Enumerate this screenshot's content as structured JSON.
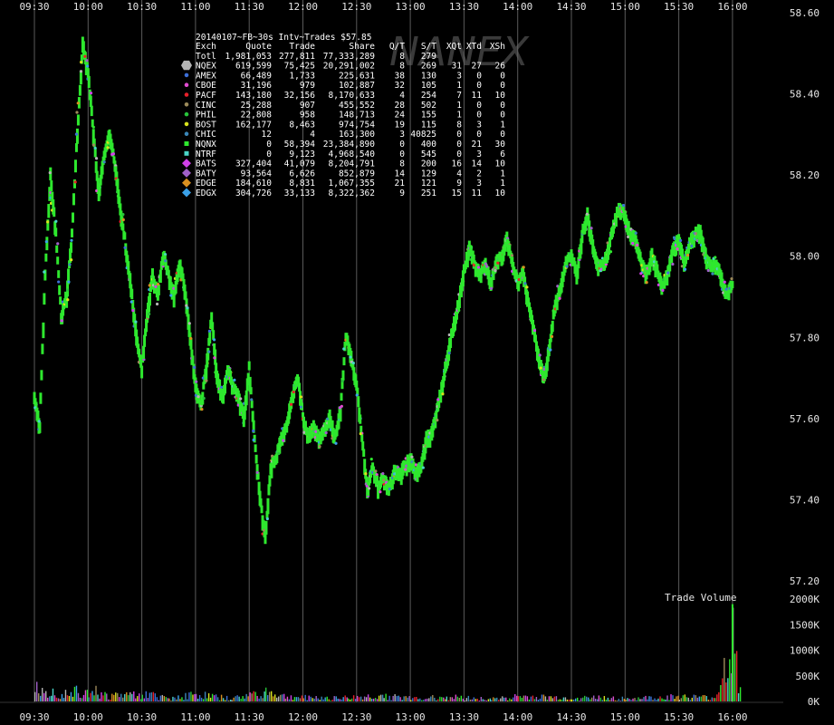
{
  "chart_data": {
    "type": "scatter",
    "title": "20140107~FB~30s Intv~Trades $57.85",
    "watermark": "NANEX",
    "background": "#000000",
    "grid": "vertical only",
    "x_ticks": [
      "09:30",
      "10:00",
      "10:30",
      "11:00",
      "11:30",
      "12:00",
      "12:30",
      "13:00",
      "13:30",
      "14:00",
      "14:30",
      "15:00",
      "15:30",
      "16:00"
    ],
    "price_axis": {
      "ylim": [
        57.1,
        58.6
      ],
      "tick_labels": [
        "58.60",
        "58.40",
        "58.20",
        "58.00",
        "57.80",
        "57.60",
        "57.40",
        "57.20"
      ],
      "tick_values": [
        58.6,
        58.4,
        58.2,
        58.0,
        57.8,
        57.6,
        57.4,
        57.2
      ]
    },
    "volume_axis": {
      "label": "Trade Volume",
      "ylim": [
        0,
        2000000
      ],
      "tick_labels": [
        "2000K",
        "1500K",
        "1000K",
        "500K",
        "0K"
      ],
      "tick_values": [
        2000000,
        1500000,
        1000000,
        500000,
        0
      ]
    },
    "table": {
      "headers": [
        "Exch",
        "Quote",
        "Trade",
        "Share",
        "Q/T",
        "S/T",
        "XQt",
        "XTd",
        "XSh"
      ],
      "total": {
        "label": "Totl",
        "quote": "1,981,053",
        "trade": "277,811",
        "share": "77,333,289",
        "qt": "8",
        "st": "279"
      },
      "rows": [
        {
          "exch": "NQEX",
          "quote": "619,599",
          "trade": "75,425",
          "share": "20,291,002",
          "qt": "8",
          "st": "269",
          "xqt": "31",
          "xtd": "27",
          "xsh": "26",
          "color": "#b4b4b4",
          "marker": "hexagon"
        },
        {
          "exch": "AMEX",
          "quote": "66,489",
          "trade": "1,733",
          "share": "225,631",
          "qt": "38",
          "st": "130",
          "xqt": "3",
          "xtd": "0",
          "xsh": "0",
          "color": "#3d6fd8",
          "marker": "circle"
        },
        {
          "exch": "CBOE",
          "quote": "31,196",
          "trade": "979",
          "share": "102,887",
          "qt": "32",
          "st": "105",
          "xqt": "1",
          "xtd": "0",
          "xsh": "0",
          "color": "#e04bd0",
          "marker": "circle"
        },
        {
          "exch": "PACF",
          "quote": "143,180",
          "trade": "32,156",
          "share": "8,170,633",
          "qt": "4",
          "st": "254",
          "xqt": "7",
          "xtd": "11",
          "xsh": "10",
          "color": "#e8202a",
          "marker": "circle"
        },
        {
          "exch": "CINC",
          "quote": "25,288",
          "trade": "907",
          "share": "455,552",
          "qt": "28",
          "st": "502",
          "xqt": "1",
          "xtd": "0",
          "xsh": "0",
          "color": "#9c8a5a",
          "marker": "circle"
        },
        {
          "exch": "PHIL",
          "quote": "22,808",
          "trade": "958",
          "share": "148,713",
          "qt": "24",
          "st": "155",
          "xqt": "1",
          "xtd": "0",
          "xsh": "0",
          "color": "#27c43a",
          "marker": "circle"
        },
        {
          "exch": "BOST",
          "quote": "162,177",
          "trade": "8,463",
          "share": "974,754",
          "qt": "19",
          "st": "115",
          "xqt": "8",
          "xtd": "3",
          "xsh": "1",
          "color": "#d8e21c",
          "marker": "circle"
        },
        {
          "exch": "CHIC",
          "quote": "12",
          "trade": "4",
          "share": "163,300",
          "qt": "3",
          "st": "40825",
          "xqt": "0",
          "xtd": "0",
          "xsh": "0",
          "color": "#3a86b8",
          "marker": "circle"
        },
        {
          "exch": "NQNX",
          "quote": "0",
          "trade": "58,394",
          "share": "23,384,890",
          "qt": "0",
          "st": "400",
          "xqt": "0",
          "xtd": "21",
          "xsh": "30",
          "color": "#2ee82e",
          "marker": "square"
        },
        {
          "exch": "NTRF",
          "quote": "0",
          "trade": "9,123",
          "share": "4,968,540",
          "qt": "0",
          "st": "545",
          "xqt": "0",
          "xtd": "3",
          "xsh": "6",
          "color": "#4ad4c8",
          "marker": "square"
        },
        {
          "exch": "BATS",
          "quote": "327,404",
          "trade": "41,079",
          "share": "8,204,791",
          "qt": "8",
          "st": "200",
          "xqt": "16",
          "xtd": "14",
          "xsh": "10",
          "color": "#d040e8",
          "marker": "diamond"
        },
        {
          "exch": "BATY",
          "quote": "93,564",
          "trade": "6,626",
          "share": "852,879",
          "qt": "14",
          "st": "129",
          "xqt": "4",
          "xtd": "2",
          "xsh": "1",
          "color": "#a060c8",
          "marker": "diamond"
        },
        {
          "exch": "EDGE",
          "quote": "184,610",
          "trade": "8,831",
          "share": "1,067,355",
          "qt": "21",
          "st": "121",
          "xqt": "9",
          "xtd": "3",
          "xsh": "1",
          "color": "#d89020",
          "marker": "diamond"
        },
        {
          "exch": "EDGX",
          "quote": "304,726",
          "trade": "33,133",
          "share": "8,322,362",
          "qt": "9",
          "st": "251",
          "xqt": "15",
          "xtd": "11",
          "xsh": "10",
          "color": "#3aa0e8",
          "marker": "diamond"
        }
      ]
    },
    "price_series": [
      [
        "09:30",
        57.65
      ],
      [
        "09:33",
        57.58
      ],
      [
        "09:36",
        57.95
      ],
      [
        "09:39",
        58.2
      ],
      [
        "09:42",
        58.05
      ],
      [
        "09:45",
        57.85
      ],
      [
        "09:48",
        57.9
      ],
      [
        "09:51",
        58.05
      ],
      [
        "09:54",
        58.3
      ],
      [
        "09:57",
        58.52
      ],
      [
        "10:00",
        58.45
      ],
      [
        "10:03",
        58.3
      ],
      [
        "10:06",
        58.15
      ],
      [
        "10:09",
        58.25
      ],
      [
        "10:12",
        58.3
      ],
      [
        "10:15",
        58.22
      ],
      [
        "10:18",
        58.12
      ],
      [
        "10:21",
        58.02
      ],
      [
        "10:24",
        57.92
      ],
      [
        "10:27",
        57.8
      ],
      [
        "10:30",
        57.72
      ],
      [
        "10:33",
        57.85
      ],
      [
        "10:36",
        57.95
      ],
      [
        "10:39",
        57.9
      ],
      [
        "10:42",
        58.0
      ],
      [
        "10:45",
        57.95
      ],
      [
        "10:48",
        57.9
      ],
      [
        "10:51",
        57.98
      ],
      [
        "10:54",
        57.92
      ],
      [
        "10:57",
        57.8
      ],
      [
        "11:00",
        57.68
      ],
      [
        "11:03",
        57.62
      ],
      [
        "11:06",
        57.72
      ],
      [
        "11:09",
        57.85
      ],
      [
        "11:12",
        57.7
      ],
      [
        "11:15",
        57.65
      ],
      [
        "11:18",
        57.72
      ],
      [
        "11:21",
        57.68
      ],
      [
        "11:24",
        57.65
      ],
      [
        "11:27",
        57.6
      ],
      [
        "11:30",
        57.72
      ],
      [
        "11:33",
        57.55
      ],
      [
        "11:36",
        57.4
      ],
      [
        "11:39",
        57.3
      ],
      [
        "11:42",
        57.48
      ],
      [
        "11:45",
        57.5
      ],
      [
        "11:48",
        57.55
      ],
      [
        "11:51",
        57.58
      ],
      [
        "11:54",
        57.65
      ],
      [
        "11:57",
        57.7
      ],
      [
        "12:00",
        57.6
      ],
      [
        "12:03",
        57.55
      ],
      [
        "12:06",
        57.58
      ],
      [
        "12:09",
        57.55
      ],
      [
        "12:12",
        57.57
      ],
      [
        "12:15",
        57.6
      ],
      [
        "12:18",
        57.55
      ],
      [
        "12:21",
        57.62
      ],
      [
        "12:24",
        57.8
      ],
      [
        "12:27",
        57.75
      ],
      [
        "12:30",
        57.68
      ],
      [
        "12:33",
        57.55
      ],
      [
        "12:36",
        57.42
      ],
      [
        "12:39",
        57.48
      ],
      [
        "12:42",
        57.43
      ],
      [
        "12:45",
        57.45
      ],
      [
        "12:48",
        57.42
      ],
      [
        "12:51",
        57.47
      ],
      [
        "12:54",
        57.46
      ],
      [
        "12:57",
        57.48
      ],
      [
        "13:00",
        57.5
      ],
      [
        "13:03",
        57.46
      ],
      [
        "13:06",
        57.48
      ],
      [
        "13:09",
        57.55
      ],
      [
        "13:12",
        57.56
      ],
      [
        "13:15",
        57.62
      ],
      [
        "13:18",
        57.68
      ],
      [
        "13:21",
        57.76
      ],
      [
        "13:24",
        57.82
      ],
      [
        "13:27",
        57.88
      ],
      [
        "13:30",
        57.96
      ],
      [
        "13:33",
        58.02
      ],
      [
        "13:36",
        57.98
      ],
      [
        "13:39",
        57.95
      ],
      [
        "13:42",
        57.98
      ],
      [
        "13:45",
        57.93
      ],
      [
        "13:48",
        57.98
      ],
      [
        "13:51",
        58.0
      ],
      [
        "13:54",
        58.04
      ],
      [
        "13:57",
        57.98
      ],
      [
        "14:00",
        57.93
      ],
      [
        "14:03",
        57.96
      ],
      [
        "14:06",
        57.88
      ],
      [
        "14:09",
        57.82
      ],
      [
        "14:12",
        57.74
      ],
      [
        "14:15",
        57.7
      ],
      [
        "14:18",
        57.78
      ],
      [
        "14:21",
        57.88
      ],
      [
        "14:24",
        57.92
      ],
      [
        "14:27",
        57.98
      ],
      [
        "14:30",
        58.0
      ],
      [
        "14:33",
        57.95
      ],
      [
        "14:36",
        58.05
      ],
      [
        "14:39",
        58.1
      ],
      [
        "14:42",
        58.02
      ],
      [
        "14:45",
        57.97
      ],
      [
        "14:48",
        57.98
      ],
      [
        "14:51",
        58.02
      ],
      [
        "14:54",
        58.08
      ],
      [
        "14:57",
        58.12
      ],
      [
        "15:00",
        58.1
      ],
      [
        "15:03",
        58.05
      ],
      [
        "15:06",
        58.04
      ],
      [
        "15:09",
        57.98
      ],
      [
        "15:12",
        57.95
      ],
      [
        "15:15",
        58.0
      ],
      [
        "15:18",
        57.96
      ],
      [
        "15:21",
        57.92
      ],
      [
        "15:24",
        57.96
      ],
      [
        "15:27",
        58.02
      ],
      [
        "15:30",
        58.04
      ],
      [
        "15:33",
        57.98
      ],
      [
        "15:36",
        58.03
      ],
      [
        "15:39",
        58.05
      ],
      [
        "15:42",
        58.06
      ],
      [
        "15:45",
        58.0
      ],
      [
        "15:48",
        57.97
      ],
      [
        "15:51",
        57.98
      ],
      [
        "15:54",
        57.94
      ],
      [
        "15:57",
        57.9
      ],
      [
        "16:00",
        57.93
      ]
    ],
    "volume_series": [
      [
        "09:30",
        900000
      ],
      [
        "09:40",
        300000
      ],
      [
        "10:00",
        420000
      ],
      [
        "10:10",
        180000
      ],
      [
        "10:30",
        250000
      ],
      [
        "10:45",
        110000
      ],
      [
        "11:00",
        230000
      ],
      [
        "11:20",
        90000
      ],
      [
        "11:39",
        330000
      ],
      [
        "11:50",
        150000
      ],
      [
        "12:00",
        130000
      ],
      [
        "12:25",
        120000
      ],
      [
        "12:45",
        190000
      ],
      [
        "13:00",
        100000
      ],
      [
        "13:20",
        150000
      ],
      [
        "13:45",
        80000
      ],
      [
        "14:00",
        160000
      ],
      [
        "14:30",
        110000
      ],
      [
        "14:45",
        130000
      ],
      [
        "15:00",
        90000
      ],
      [
        "15:30",
        150000
      ],
      [
        "15:50",
        120000
      ],
      [
        "16:00",
        1900000
      ],
      [
        "16:05",
        300000
      ]
    ]
  }
}
